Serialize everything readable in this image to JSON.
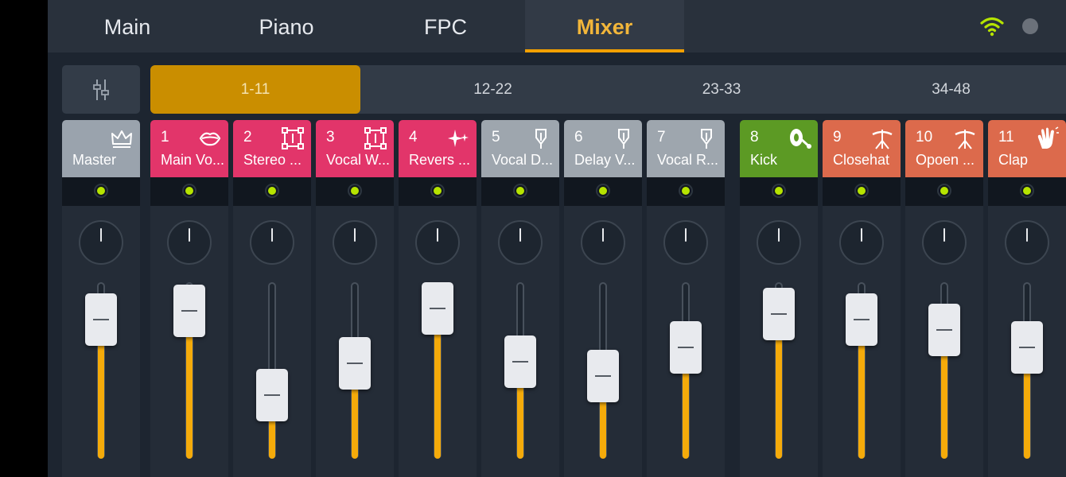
{
  "nav": {
    "tabs": [
      {
        "label": "Main"
      },
      {
        "label": "Piano"
      },
      {
        "label": "FPC"
      },
      {
        "label": "Mixer"
      }
    ],
    "active_tab": "Mixer"
  },
  "ranges": {
    "tabs": [
      {
        "label": "1-11"
      },
      {
        "label": "12-22"
      },
      {
        "label": "23-33"
      },
      {
        "label": "34-48"
      }
    ],
    "active": "1-11"
  },
  "colors": {
    "accent": "#f2a000",
    "master": "#9aa3ad",
    "vocal": "#e2356a",
    "send": "#9ea6ae",
    "kick": "#5c9a24",
    "drums": "#dc6a4c",
    "fader_fill": "#f5ab0a",
    "led": "#b6e400"
  },
  "channels": [
    {
      "number": "",
      "name": "Master",
      "color": "#9aa3ad",
      "icon": "crown-icon",
      "level": 0.79
    },
    {
      "number": "1",
      "name": "Main Vo...",
      "color": "#e2356a",
      "icon": "lips-icon",
      "level": 0.84
    },
    {
      "number": "2",
      "name": "Stereo ...",
      "color": "#e2356a",
      "icon": "stereo-icon",
      "level": 0.36
    },
    {
      "number": "3",
      "name": "Vocal W...",
      "color": "#e2356a",
      "icon": "stereo-icon",
      "level": 0.54
    },
    {
      "number": "4",
      "name": "Revers ...",
      "color": "#e2356a",
      "icon": "sparkle-icon",
      "level": 0.85
    },
    {
      "number": "5",
      "name": "Vocal D...",
      "color": "#9ea6ae",
      "icon": "send-icon",
      "level": 0.55
    },
    {
      "number": "6",
      "name": "Delay V...",
      "color": "#9ea6ae",
      "icon": "send-icon",
      "level": 0.47
    },
    {
      "number": "7",
      "name": "Vocal R...",
      "color": "#9ea6ae",
      "icon": "send-icon",
      "level": 0.63
    },
    {
      "number": "8",
      "name": "Kick",
      "color": "#5c9a24",
      "icon": "kick-drum-icon",
      "level": 0.82
    },
    {
      "number": "9",
      "name": "Closehat",
      "color": "#dc6a4c",
      "icon": "hihat-icon",
      "level": 0.79
    },
    {
      "number": "10",
      "name": "Opoen ...",
      "color": "#dc6a4c",
      "icon": "hihat-icon",
      "level": 0.73
    },
    {
      "number": "11",
      "name": "Clap",
      "color": "#dc6a4c",
      "icon": "clap-icon",
      "level": 0.63
    }
  ]
}
